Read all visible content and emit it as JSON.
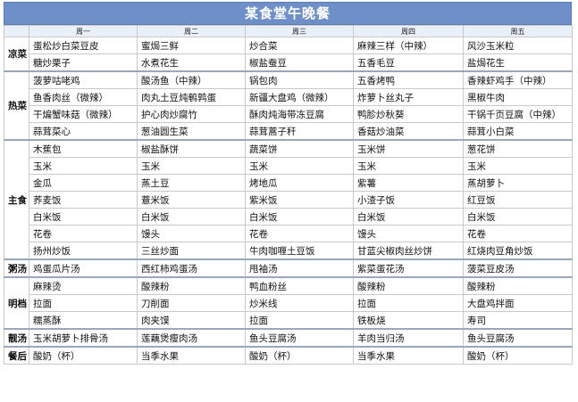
{
  "title": "某食堂午晚餐",
  "days": [
    "周一",
    "周二",
    "周三",
    "周四",
    "周五"
  ],
  "colors": {
    "green": "#3f9a5e",
    "red": "#e04e3a",
    "header": "#6f8fc8"
  },
  "sections": [
    {
      "name": "凉菜",
      "rows": [
        [
          {
            "t": "蛋松炒白菜豆皮",
            "c": "k"
          },
          {
            "t": "蜜焗三鲜",
            "c": "k"
          },
          {
            "t": "炒合菜",
            "c": "k"
          },
          {
            "t": "麻辣三样（中辣）",
            "c": "k"
          },
          {
            "t": "风沙玉米粒",
            "c": "k"
          }
        ],
        [
          {
            "t": "糖炒栗子",
            "c": "k"
          },
          {
            "t": "水煮花生",
            "c": "k"
          },
          {
            "t": "椒盐蚕豆",
            "c": "k"
          },
          {
            "t": "五香毛豆",
            "c": "k"
          },
          {
            "t": "盐焗花生",
            "c": "k"
          }
        ]
      ]
    },
    {
      "name": "热菜",
      "rows": [
        [
          {
            "t": "菠萝咕咾鸡",
            "c": "k"
          },
          {
            "t": "酸汤鱼（中辣）",
            "c": "k"
          },
          {
            "t": "锅包肉",
            "c": "k"
          },
          {
            "t": "五香烤鸭",
            "c": "k"
          },
          {
            "t": "香辣虾鸡手（中辣）",
            "c": "k"
          }
        ],
        [
          {
            "t": "鱼香肉丝（微辣）",
            "c": "k"
          },
          {
            "t": "肉丸土豆炖鹌鹑蛋",
            "c": "k"
          },
          {
            "t": "新疆大盘鸡（微辣）",
            "c": "k"
          },
          {
            "t": "炸萝卜丝丸子",
            "c": "k"
          },
          {
            "t": "黑椒牛肉",
            "c": "k"
          }
        ],
        [
          {
            "t": "干煸蟹味菇（微辣）",
            "c": "k"
          },
          {
            "t": "护心肉炒腐竹",
            "c": "k"
          },
          {
            "t": "酥肉炖海带冻豆腐",
            "c": "k"
          },
          {
            "t": "鸭胗炒秋葵",
            "c": "k"
          },
          {
            "t": "干锅千页豆腐（中辣）",
            "c": "k"
          }
        ],
        [
          {
            "t": "蒜茸菜心",
            "c": "k"
          },
          {
            "t": "葱油圆生菜",
            "c": "k"
          },
          {
            "t": "蒜茸蒿子秆",
            "c": "k"
          },
          {
            "t": "香菇炒油菜",
            "c": "k"
          },
          {
            "t": "蒜茸小白菜",
            "c": "k"
          }
        ]
      ]
    },
    {
      "name": "主食",
      "rows": [
        [
          {
            "t": "木蕉包",
            "c": "r"
          },
          {
            "t": "椒盐酥饼",
            "c": "r"
          },
          {
            "t": "蔬菜饼",
            "c": "g"
          },
          {
            "t": "玉米饼",
            "c": "g"
          },
          {
            "t": "葱花饼",
            "c": "r"
          }
        ],
        [
          {
            "t": "玉米",
            "c": "g"
          },
          {
            "t": "玉米",
            "c": "g"
          },
          {
            "t": "玉米",
            "c": "g"
          },
          {
            "t": "玉米",
            "c": "g"
          },
          {
            "t": "玉米",
            "c": "g"
          }
        ],
        [
          {
            "t": "金瓜",
            "c": "g"
          },
          {
            "t": "蒸土豆",
            "c": "g"
          },
          {
            "t": "烤地瓜",
            "c": "g"
          },
          {
            "t": "紫薯",
            "c": "g"
          },
          {
            "t": "蒸胡萝卜",
            "c": "g"
          }
        ],
        [
          {
            "t": "荞麦饭",
            "c": "g"
          },
          {
            "t": "薏米饭",
            "c": "g"
          },
          {
            "t": "紫米饭",
            "c": "g"
          },
          {
            "t": "小渣子饭",
            "c": "g"
          },
          {
            "t": "红豆饭",
            "c": "g"
          }
        ],
        [
          {
            "t": "白米饭",
            "c": "g"
          },
          {
            "t": "白米饭",
            "c": "g"
          },
          {
            "t": "白米饭",
            "c": "g"
          },
          {
            "t": "白米饭",
            "c": "g"
          },
          {
            "t": "白米饭",
            "c": "g"
          }
        ],
        [
          {
            "t": "花卷",
            "c": "g"
          },
          {
            "t": "馒头",
            "c": "g"
          },
          {
            "t": "花卷",
            "c": "g"
          },
          {
            "t": "馒头",
            "c": "g"
          },
          {
            "t": "花卷",
            "c": "g"
          }
        ],
        [
          {
            "t": "扬州炒饭",
            "c": "r"
          },
          {
            "t": "三丝炒面",
            "c": "r"
          },
          {
            "t": "牛肉咖喱土豆饭",
            "c": "r"
          },
          {
            "t": "甘蓝尖椒肉丝炒饼",
            "c": "r"
          },
          {
            "t": "红烧肉豆角炒饭",
            "c": "r"
          }
        ]
      ]
    },
    {
      "name": "粥汤",
      "rows": [
        [
          {
            "t": "鸡蛋瓜片汤",
            "c": "k"
          },
          {
            "t": "西红柿鸡蛋汤",
            "c": "k"
          },
          {
            "t": "甩袖汤",
            "c": "k"
          },
          {
            "t": "紫菜蛋花汤",
            "c": "k"
          },
          {
            "t": "菠菜豆皮汤",
            "c": "k"
          }
        ]
      ]
    },
    {
      "name": "明档",
      "rows": [
        [
          {
            "t": "麻辣烫",
            "c": "g"
          },
          {
            "t": "酸辣粉",
            "c": "g"
          },
          {
            "t": "鸭血粉丝",
            "c": "g"
          },
          {
            "t": "酸辣粉",
            "c": "g"
          },
          {
            "t": "酸辣粉",
            "c": "g"
          }
        ],
        [
          {
            "t": "拉面",
            "c": "g"
          },
          {
            "t": "刀削面",
            "c": "g"
          },
          {
            "t": "炒米线",
            "c": "g"
          },
          {
            "t": "拉面",
            "c": "g"
          },
          {
            "t": "大盘鸡拌面",
            "c": "k"
          }
        ],
        [
          {
            "t": "糯蒸酥",
            "c": "r"
          },
          {
            "t": "肉夹馍",
            "c": "g"
          },
          {
            "t": "拉面",
            "c": "g"
          },
          {
            "t": "铁板烧",
            "c": "k"
          },
          {
            "t": "寿司",
            "c": "g"
          }
        ]
      ]
    },
    {
      "name": "靓汤",
      "rows": [
        [
          {
            "t": "玉米胡萝卜排骨汤",
            "c": "k"
          },
          {
            "t": "莲藕煲瘦肉汤",
            "c": "k"
          },
          {
            "t": "鱼头豆腐汤",
            "c": "k"
          },
          {
            "t": "羊肉当归汤",
            "c": "k"
          },
          {
            "t": "鱼头豆腐汤",
            "c": "k"
          }
        ]
      ]
    },
    {
      "name": "餐后",
      "rows": [
        [
          {
            "t": "酸奶（杯）",
            "c": "k"
          },
          {
            "t": "当季水果",
            "c": "k"
          },
          {
            "t": "酸奶（杯）",
            "c": "k"
          },
          {
            "t": "当季水果",
            "c": "k"
          },
          {
            "t": "酸奶（杯）",
            "c": "k"
          }
        ]
      ]
    }
  ]
}
